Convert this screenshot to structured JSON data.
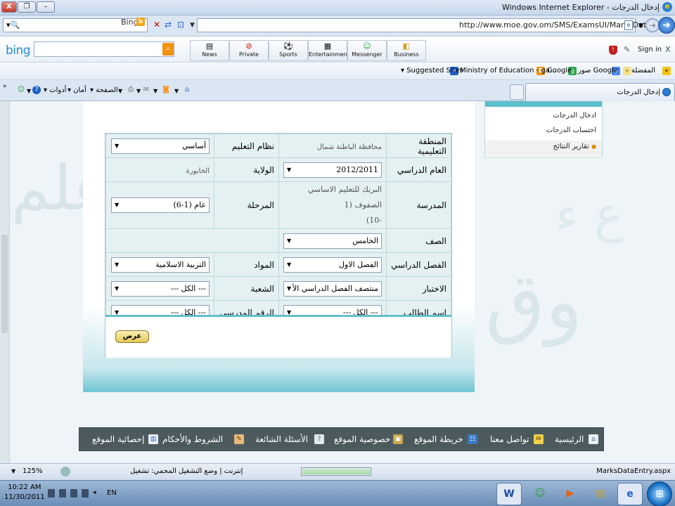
{
  "window": {
    "title": "Windows Internet Explorer - إدخال الدرجات",
    "min_glyph": "–",
    "max_glyph": "❐",
    "close_glyph": "X"
  },
  "address": {
    "url": "http://www.moe.gov.om/SMS/ExamsUI/MarksDataEntry.aspx",
    "search_provider": "Bing"
  },
  "bing_toolbar": {
    "logo": "bing",
    "buttons": [
      "News",
      "Private",
      "Sports",
      "Entertainment",
      "Messenger",
      "Business"
    ],
    "sign_in": "Sign in",
    "close": "X"
  },
  "favorites": {
    "favorites_label": "المفضلة",
    "images_label": "صور Google",
    "google_label": "Google",
    "ministry_label": "Ministry of Education - ga...",
    "suggested_label": "Suggested Sites"
  },
  "tabs": {
    "active_tab": "إدخال الدرجات"
  },
  "commands": {
    "page": "الصفحة",
    "safety": "أمان",
    "tools": "أدوات"
  },
  "side_menu": {
    "items": [
      "ادخال الدرجات",
      "احتساب الدرجات",
      "تقارير النتائج"
    ]
  },
  "form": {
    "region_label": "المنطقة التعليمية",
    "region_value": "محافظة الباطنة شمال",
    "system_label": "نظام التعليم",
    "system_value": "أساسي",
    "year_label": "العام الدراسي",
    "year_value": "2012/2011",
    "wilayat_label": "الولاية",
    "wilayat_value": "الخابورة",
    "school_label": "المدرسة",
    "school_value_line1": "البريك للتعليم الاساسي الصفوف (1",
    "school_value_line2": "-10)",
    "stage_label": "المرحلة",
    "stage_value": "عام (1-6)",
    "grade_label": "الصف",
    "grade_value": "الخامس",
    "semester_label": "الفصل الدراسي",
    "semester_value": "الفصل الاول",
    "subject_label": "المواد",
    "subject_value": "التربية الاسلامية",
    "exam_label": "الاختبار",
    "exam_value": "منتصف الفصل الدراسي الأ",
    "section_label": "الشعبة",
    "section_value": "--- الكل ---",
    "student_label": "اسم الطالب",
    "student_value": "--- الكل ---",
    "school_no_label": "الرقم المدرسي",
    "school_no_value": "--- الكل ---",
    "show_button": "عرض"
  },
  "footer_links": [
    "الرئيسية",
    "تواصل معنا",
    "خريطة الموقع",
    "خصوصية الموقع",
    "الأسئلة الشائعة",
    "الشروط والأحكام",
    "إحصائية الموقع"
  ],
  "status": {
    "page_name": "MarksDataEntry.aspx",
    "zone": "إنترنت | وضع التشغيل المحمي: تشغيل",
    "zoom": "125%"
  },
  "taskbar": {
    "time": "10:22 AM",
    "date": "11/30/2011",
    "lang": "EN"
  },
  "colors": {
    "teal_accent": "#63bfcb",
    "footer_bg": "#4d5a5d",
    "cell_bg": "#e4f1f3"
  }
}
